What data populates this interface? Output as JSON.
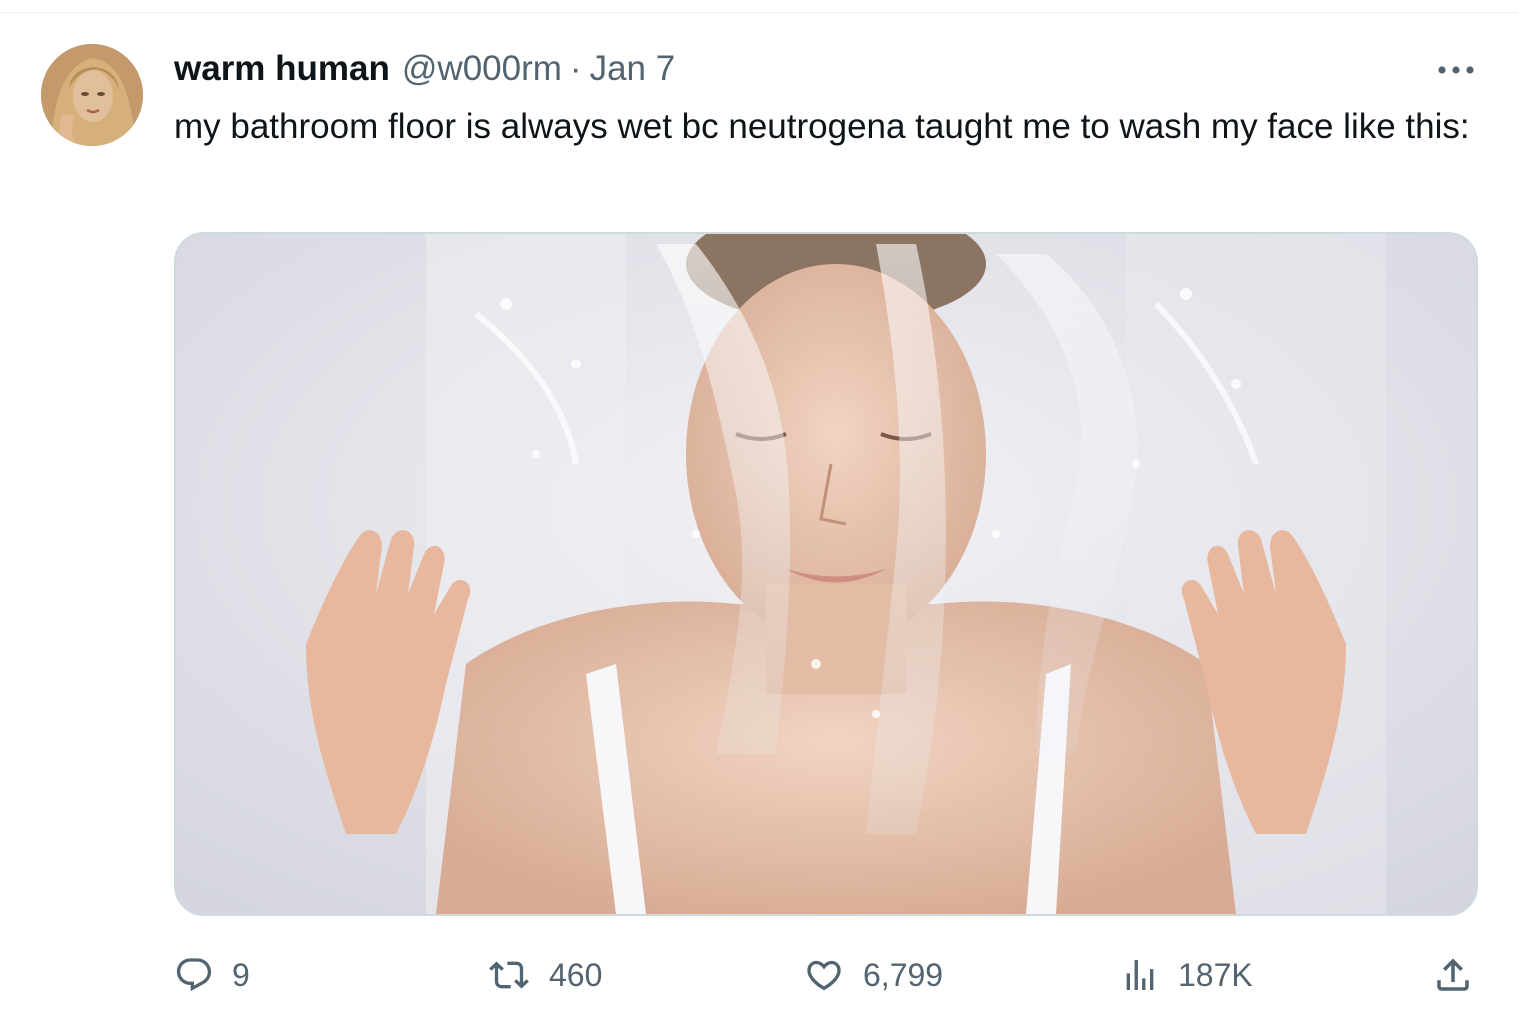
{
  "tweet": {
    "author": {
      "display_name": "warm human",
      "handle": "@w000rm",
      "avatar_icon": "profile-photo"
    },
    "separator": "·",
    "timestamp": "Jan 7",
    "text": "my bathroom floor is always wet bc neutrogena taught me to wash my face like this:",
    "media": {
      "type": "image",
      "icon": "photo-woman-splashing-water-on-face"
    },
    "actions": {
      "reply": {
        "icon": "reply-icon",
        "count": "9"
      },
      "retweet": {
        "icon": "retweet-icon",
        "count": "460"
      },
      "like": {
        "icon": "heart-icon",
        "count": "6,799"
      },
      "views": {
        "icon": "views-chart-icon",
        "count": "187K"
      },
      "share": {
        "icon": "share-icon"
      }
    },
    "more_icon": "more-dots-icon"
  },
  "colors": {
    "text_primary": "#0f1419",
    "text_secondary": "#536471",
    "border": "#cfd9de"
  }
}
